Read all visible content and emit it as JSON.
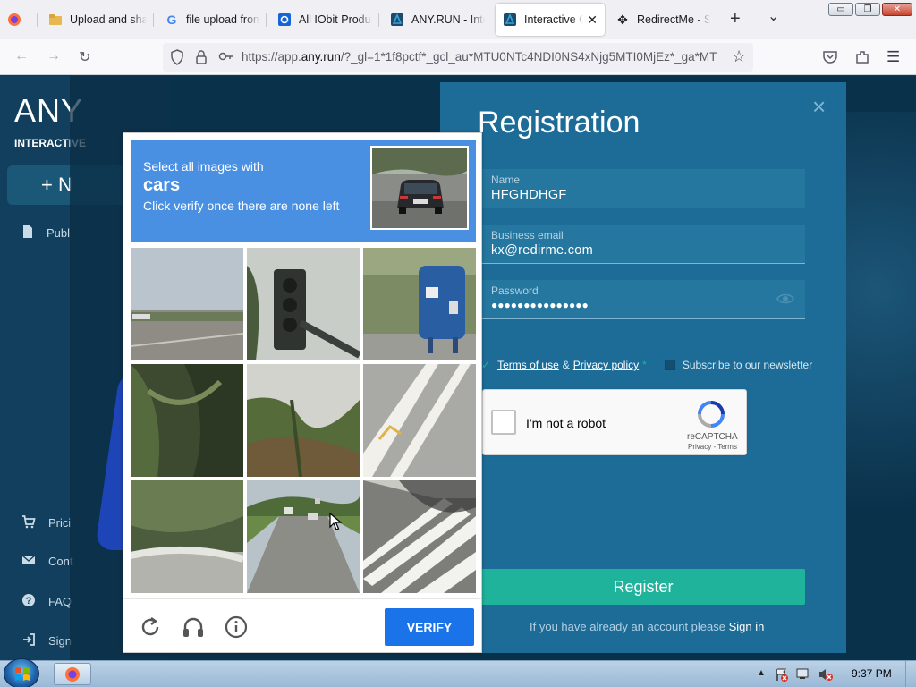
{
  "browser": {
    "tabs": [
      {
        "label": "",
        "icon": "firefox-icon"
      },
      {
        "label": "Upload and sha",
        "icon": "folder-icon"
      },
      {
        "label": "file upload from",
        "icon": "google-icon"
      },
      {
        "label": "All IObit Produc",
        "icon": "iobit-icon"
      },
      {
        "label": "ANY.RUN - Inte",
        "icon": "anyrun-icon"
      },
      {
        "label": "Interactive O",
        "icon": "anyrun-icon",
        "active": true
      },
      {
        "label": "RedirectMe - Sh",
        "icon": "redirectme-icon"
      }
    ],
    "new_tab": "+",
    "list_tabs": "⌄",
    "window_controls": {
      "minimize": "▭",
      "restore": "❐",
      "close": "✕"
    },
    "url_prefix": "https://app.",
    "url_domain": "any.run",
    "url_rest": "/?_gl=1*1f8pctf*_gcl_au*MTU0NTc4NDI0NS4xNjg5MTI0MjEz*_ga*MT"
  },
  "app": {
    "brand": "ANY",
    "brand_sub": "INTERACTIVE",
    "new_button": "+ N",
    "sidebar": [
      {
        "label": "Publ",
        "icon": "document-icon"
      },
      {
        "label": "Prici",
        "icon": "cart-icon"
      },
      {
        "label": "Cont",
        "icon": "mail-icon"
      },
      {
        "label": "FAQ",
        "icon": "help-icon"
      },
      {
        "label": "Sign",
        "icon": "signin-icon"
      }
    ]
  },
  "registration": {
    "title": "Registration",
    "close": "×",
    "name_label": "Name",
    "name_value": "HFGHDHGF",
    "email_label": "Business email",
    "email_value": "kx@redirme.com",
    "password_label": "Password",
    "password_value": "●●●●●●●●●●●●●●●",
    "terms_link": "Terms of use",
    "terms_amp": "&",
    "privacy_link": "Privacy policy",
    "required_mark": "*",
    "newsletter_label": "Subscribe to our newsletter",
    "recaptcha_text": "I'm not a robot",
    "recaptcha_brand": "reCAPTCHA",
    "recaptcha_links": "Privacy - Terms",
    "register_button": "Register",
    "signin_prompt": "If you have already an account please",
    "signin_link": "Sign in"
  },
  "captcha": {
    "instruction_line1": "Select all images with",
    "target": "cars",
    "instruction_line2": "Click verify once there are none left",
    "verify_button": "VERIFY"
  },
  "taskbar": {
    "clock": "9:37 PM"
  },
  "colors": {
    "accent_blue": "#4a90e2",
    "verify_blue": "#1a73e8",
    "register_green": "#1fb39c",
    "panel_blue": "#1d6c98"
  }
}
